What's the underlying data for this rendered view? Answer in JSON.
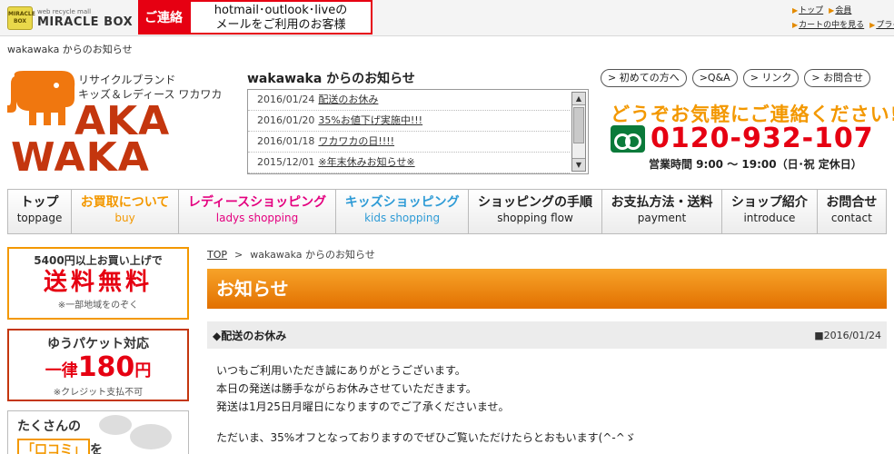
{
  "top": {
    "mall_sub": "web recycle mall",
    "mall_name": "MIRACLE BOX",
    "mall_icon_text": "MIRACLE BOX",
    "contact_label": "ご連絡",
    "contact_notice_1": "hotmail･outlook･liveの",
    "contact_notice_2": "メールをご利用のお客様",
    "links_row1": [
      "トップ",
      "会員"
    ],
    "links_row2": [
      "カートの中を見る",
      "プライ"
    ]
  },
  "breadcrumb_top": "wakawaka からのお知らせ",
  "logo": {
    "tagline_1": "リサイクルブランド",
    "tagline_2": "キッズ＆レディース ワカワカ",
    "word1": "AKA",
    "word2": "WAKA"
  },
  "news": {
    "title": "wakawaka からのお知らせ",
    "items": [
      {
        "date": "2016/01/24",
        "text": "配送のお休み"
      },
      {
        "date": "2016/01/20",
        "text": "35%お値下げ実施中!!!"
      },
      {
        "date": "2016/01/18",
        "text": "ワカワカの日!!!!"
      },
      {
        "date": "2015/12/01",
        "text": "※年末休みお知らせ※"
      }
    ]
  },
  "pills": [
    "> 初めての方へ",
    ">Q&A",
    "> リンク",
    "> お問合せ"
  ],
  "contact": {
    "call_text": "どうぞお気軽にご連絡ください!",
    "phone": "0120-932-107",
    "hours": "営業時間 9:00 〜 19:00（日･祝 定休日）",
    "colors": {
      "call": "#f39800",
      "phone": "#e60012",
      "freedial": "#0a7a3a"
    }
  },
  "nav": [
    {
      "jp": "トップ",
      "en": "toppage",
      "color": "#222222"
    },
    {
      "jp": "お買取について",
      "en": "buy",
      "color": "#f39800"
    },
    {
      "jp": "レディースショッピング",
      "en": "ladys shopping",
      "color": "#e4007f"
    },
    {
      "jp": "キッズショッピング",
      "en": "kids shopping",
      "color": "#2e9bd6"
    },
    {
      "jp": "ショッピングの手順",
      "en": "shopping flow",
      "color": "#222222"
    },
    {
      "jp": "お支払方法・送料",
      "en": "payment",
      "color": "#222222"
    },
    {
      "jp": "ショップ紹介",
      "en": "introduce",
      "color": "#222222"
    },
    {
      "jp": "お問合せ",
      "en": "contact",
      "color": "#222222"
    }
  ],
  "sidebar": {
    "free_shipping_top": "5400円以上お買い上げで",
    "free_shipping_main": "送料無料",
    "free_shipping_note": "※一部地域をのぞく",
    "yupacket_top": "ゆうパケット対応",
    "yupacket_prefix": "一律",
    "yupacket_price": "180",
    "yupacket_unit": "円",
    "yupacket_note": "※クレジット支払不可",
    "reviews_line1": "たくさんの",
    "reviews_kuchi": "「口コミ」",
    "reviews_suffix": "を"
  },
  "content": {
    "crumb_top": "TOP",
    "crumb_sep": ">",
    "crumb_current": "wakawaka からのお知らせ",
    "heading": "お知らせ",
    "post_title": "◆配送のお休み",
    "post_date": "■2016/01/24",
    "body": [
      "いつもご利用いただき誠にありがとうございます。",
      "本日の発送は勝手ながらお休みさせていただきます。",
      "発送は1月25日月曜日になりますのでご了承くださいませ。",
      "ただいま、35%オフとなっておりますのでぜひご覧いただけたらとおもいます(^-^ゞ"
    ],
    "accent_color": "#f39800"
  }
}
